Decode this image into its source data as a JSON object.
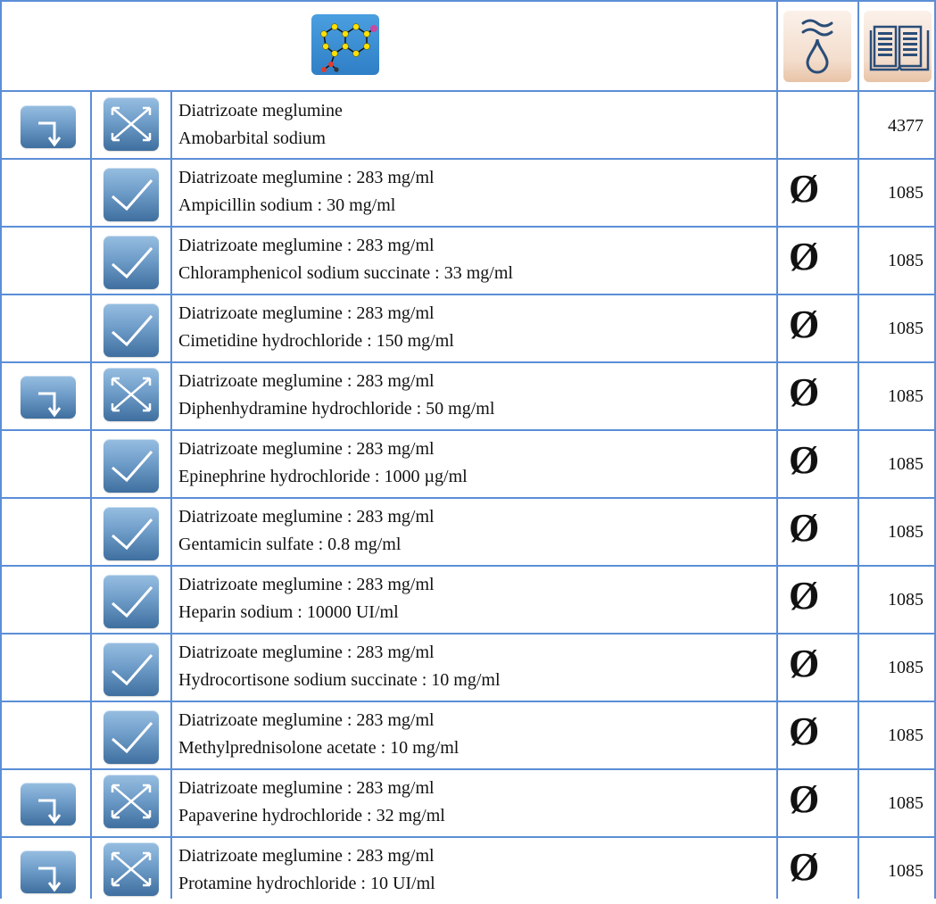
{
  "header": {
    "molecule_icon": "molecule-structure-icon",
    "solubility_icon": "solubility-drop-icon",
    "reference_icon": "open-book-icon"
  },
  "rows": [
    {
      "d1": "Diatrizoate meglumine",
      "d2": "Amobarbital sodium",
      "route": true,
      "x": true,
      "check": false,
      "empty": "",
      "ref": "4377"
    },
    {
      "d1": "Diatrizoate meglumine : 283 mg/ml",
      "d2": "Ampicillin sodium : 30 mg/ml",
      "route": false,
      "x": false,
      "check": true,
      "empty": "Ø",
      "ref": "1085"
    },
    {
      "d1": "Diatrizoate meglumine : 283 mg/ml",
      "d2": "Chloramphenicol sodium succinate : 33 mg/ml",
      "route": false,
      "x": false,
      "check": true,
      "empty": "Ø",
      "ref": "1085"
    },
    {
      "d1": "Diatrizoate meglumine : 283 mg/ml",
      "d2": "Cimetidine hydrochloride : 150 mg/ml",
      "route": false,
      "x": false,
      "check": true,
      "empty": "Ø",
      "ref": "1085"
    },
    {
      "d1": "Diatrizoate meglumine : 283 mg/ml",
      "d2": "Diphenhydramine hydrochloride : 50 mg/ml",
      "route": true,
      "x": true,
      "check": false,
      "empty": "Ø",
      "ref": "1085"
    },
    {
      "d1": "Diatrizoate meglumine : 283 mg/ml",
      "d2": "Epinephrine hydrochloride : 1000 µg/ml",
      "route": false,
      "x": false,
      "check": true,
      "empty": "Ø",
      "ref": "1085"
    },
    {
      "d1": "Diatrizoate meglumine : 283 mg/ml",
      "d2": "Gentamicin sulfate : 0.8 mg/ml",
      "route": false,
      "x": false,
      "check": true,
      "empty": "Ø",
      "ref": "1085"
    },
    {
      "d1": "Diatrizoate meglumine : 283 mg/ml",
      "d2": "Heparin sodium : 10000 UI/ml",
      "route": false,
      "x": false,
      "check": true,
      "empty": "Ø",
      "ref": "1085"
    },
    {
      "d1": "Diatrizoate meglumine : 283 mg/ml",
      "d2": "Hydrocortisone sodium succinate : 10 mg/ml",
      "route": false,
      "x": false,
      "check": true,
      "empty": "Ø",
      "ref": "1085"
    },
    {
      "d1": "Diatrizoate meglumine : 283 mg/ml",
      "d2": "Methylprednisolone acetate : 10 mg/ml",
      "route": false,
      "x": false,
      "check": true,
      "empty": "Ø",
      "ref": "1085"
    },
    {
      "d1": "Diatrizoate meglumine : 283 mg/ml",
      "d2": "Papaverine hydrochloride : 32 mg/ml",
      "route": true,
      "x": true,
      "check": false,
      "empty": "Ø",
      "ref": "1085"
    },
    {
      "d1": "Diatrizoate meglumine : 283 mg/ml",
      "d2": "Protamine hydrochloride : 10 UI/ml",
      "route": true,
      "x": true,
      "check": false,
      "empty": "Ø",
      "ref": "1085"
    }
  ]
}
